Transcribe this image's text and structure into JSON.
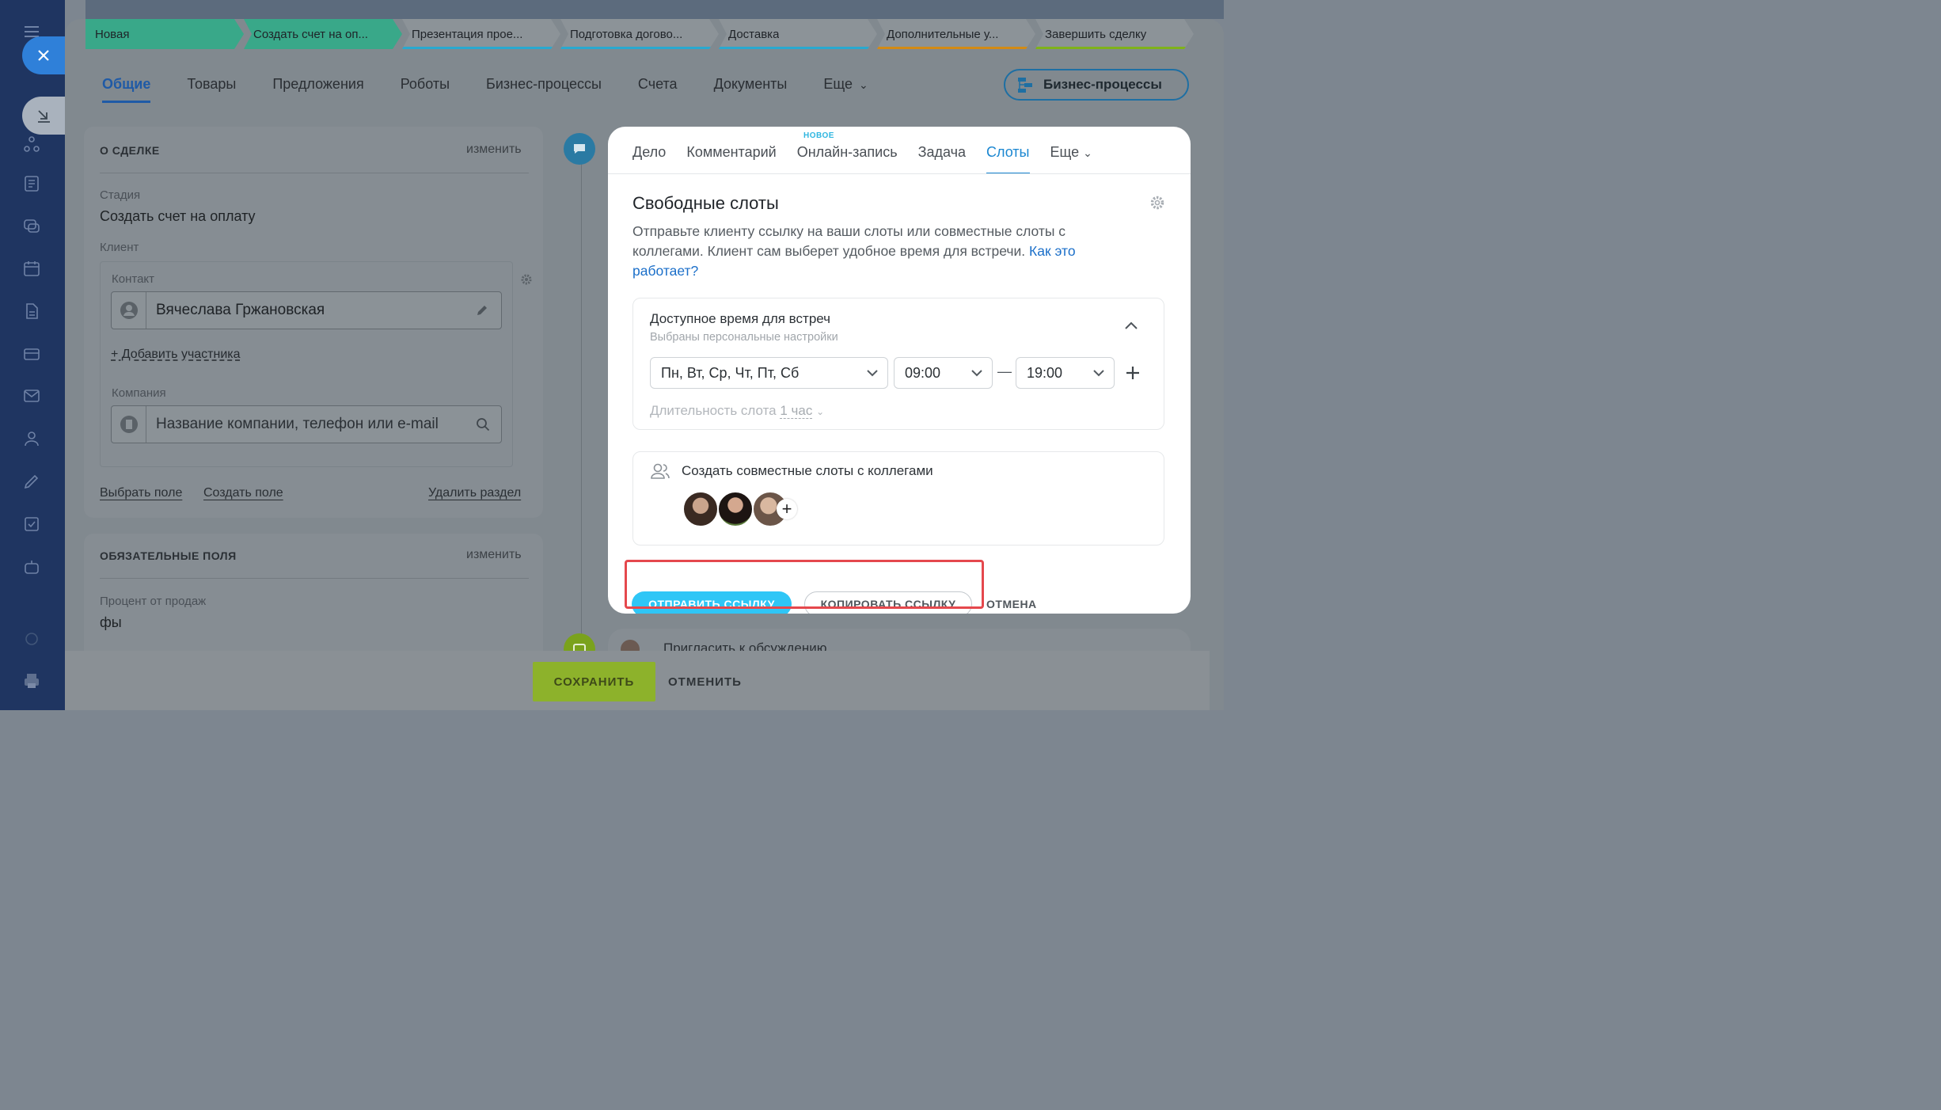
{
  "stages": [
    {
      "label": "Новая",
      "color": "#39a889",
      "line": ""
    },
    {
      "label": "Создать счет на оп...",
      "color": "#39a889",
      "line": ""
    },
    {
      "label": "Презентация прое...",
      "color": "#8c9398",
      "line": "#2aa9cf"
    },
    {
      "label": "Подготовка догово...",
      "color": "#8c9398",
      "line": "#2aa9cf"
    },
    {
      "label": "Доставка",
      "color": "#8c9398",
      "line": "#2aa9cf"
    },
    {
      "label": "Дополнительные у...",
      "color": "#8c9398",
      "line": "#d38a14"
    },
    {
      "label": "Завершить сделку",
      "color": "#8c9398",
      "line": "#7fb21a"
    }
  ],
  "tabs": [
    "Общие",
    "Товары",
    "Предложения",
    "Роботы",
    "Бизнес-процессы",
    "Счета",
    "Документы",
    "Еще"
  ],
  "bp_button": "Бизнес-процессы",
  "about": {
    "title": "О СДЕЛКЕ",
    "edit": "изменить",
    "stage_label": "Стадия",
    "stage_value": "Создать счет на оплату",
    "client_label": "Клиент",
    "contact_label": "Контакт",
    "contact_value": "Вячеслава Гржановская",
    "add_participant": "+ Добавить участника",
    "company_label": "Компания",
    "company_placeholder": "Название компании, телефон или e-mail",
    "choose_field": "Выбрать поле",
    "create_field": "Создать поле",
    "delete_section": "Удалить раздел"
  },
  "required": {
    "title": "ОБЯЗАТЕЛЬНЫЕ ПОЛЯ",
    "edit": "изменить",
    "percent_label": "Процент от продаж",
    "percent_value": "фы"
  },
  "popup": {
    "tabs": [
      "Дело",
      "Комментарий",
      "Онлайн-запись",
      "Задача",
      "Слоты",
      "Еще"
    ],
    "new_badge": "НОВОЕ",
    "title": "Свободные слоты",
    "desc": "Отправьте клиенту ссылку на ваши слоты или совместные слоты с коллегами. Клиент сам выберет удобное время для встречи.",
    "desc_link": "Как это работает?",
    "avail_title": "Доступное время для встреч",
    "avail_sub": "Выбраны персональные настройки",
    "days": "Пн, Вт, Ср, Чт, Пт, Сб",
    "time_from": "09:00",
    "time_to": "19:00",
    "dash": "—",
    "duration_label": "Длительность слота",
    "duration_value": "1 час",
    "colleagues_title": "Создать совместные слоты с коллегами",
    "send": "ОТПРАВИТЬ ССЫЛКУ",
    "copy": "КОПИРОВАТЬ ССЫЛКУ",
    "cancel": "ОТМЕНА"
  },
  "invite": "Пригласить к обсуждению",
  "bottom": {
    "save": "СОХРАНИТЬ",
    "cancel": "ОТМЕНИТЬ"
  },
  "colors": {
    "accent": "#2fc6f6",
    "link": "#1b6fc9",
    "highlight": "#e5484d",
    "save": "#8db22b"
  }
}
